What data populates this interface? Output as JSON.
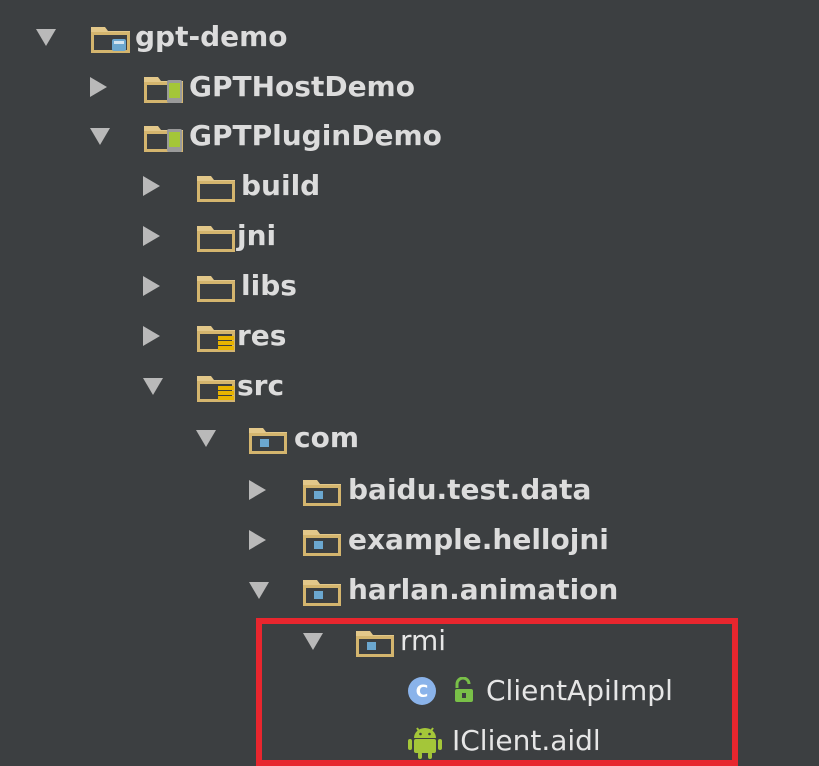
{
  "tree": {
    "rows": [
      {
        "label": "gpt-demo",
        "expanded": true,
        "icon": "project-folder-icon"
      },
      {
        "label": "GPTHostDemo",
        "expanded": false,
        "icon": "android-module-folder-icon"
      },
      {
        "label": "GPTPluginDemo",
        "expanded": true,
        "icon": "android-module-folder-icon"
      },
      {
        "label": "build",
        "expanded": false,
        "icon": "folder-icon"
      },
      {
        "label": "jni",
        "expanded": false,
        "icon": "folder-icon"
      },
      {
        "label": "libs",
        "expanded": false,
        "icon": "folder-icon"
      },
      {
        "label": "res",
        "expanded": false,
        "icon": "resource-folder-icon"
      },
      {
        "label": "src",
        "expanded": true,
        "icon": "source-root-folder-icon"
      },
      {
        "label": "com",
        "expanded": true,
        "icon": "package-folder-icon"
      },
      {
        "label": "baidu.test.data",
        "expanded": false,
        "icon": "package-folder-icon"
      },
      {
        "label": "example.hellojni",
        "expanded": false,
        "icon": "package-folder-icon"
      },
      {
        "label": "harlan.animation",
        "expanded": true,
        "icon": "package-folder-icon"
      },
      {
        "label": "rmi",
        "expanded": true,
        "icon": "package-folder-icon"
      },
      {
        "label": "ClientApiImpl",
        "icon": "java-class-icon",
        "modifier_icon": "unlocked-icon"
      },
      {
        "label": "IClient.aidl",
        "icon": "android-icon"
      }
    ]
  },
  "colors": {
    "background": "#3c3f41",
    "text": "#dcdcdc",
    "highlight_border": "#e8262e",
    "folder": "#e3c88a",
    "package_dot": "#6ba7cf",
    "class_badge": "#8ab3ea",
    "android": "#a4c639",
    "lock": "#79c048"
  }
}
